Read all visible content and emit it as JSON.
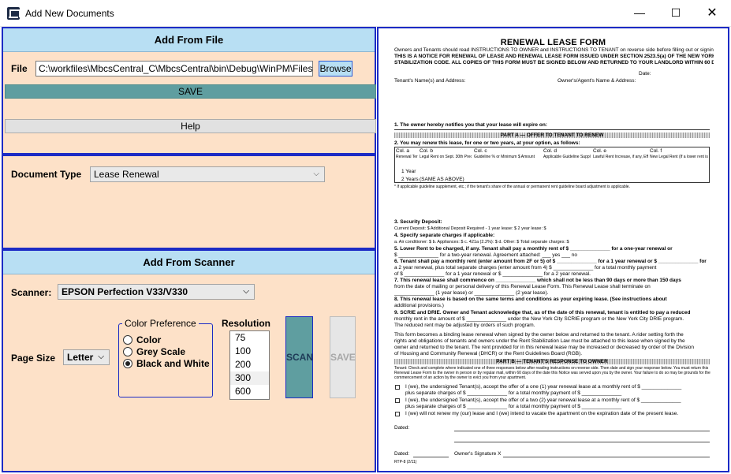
{
  "window": {
    "title": "Add New Documents",
    "controls": {
      "minimize": "—",
      "maximize": "☐",
      "close": "✕"
    }
  },
  "add_from_file": {
    "header": "Add From File",
    "file_label": "File",
    "file_value": "C:\\workfiles\\MbcsCentral_C\\MbcsCentral\\bin\\Debug\\WinPM\\Files",
    "browse_label": "Browse",
    "save_label": "SAVE",
    "help_label": "Help"
  },
  "document_type": {
    "label": "Document Type",
    "selected": "Lease Renewal"
  },
  "add_from_scanner": {
    "header": "Add From Scanner",
    "scanner_label": "Scanner:",
    "scanner_selected": "EPSON Perfection V33/V330",
    "page_size_label": "Page Size",
    "page_size_selected": "Letter",
    "color_preference": {
      "legend": "Color Preference",
      "options": [
        "Color",
        "Grey Scale",
        "Black and White"
      ],
      "selected_index": 2
    },
    "resolution": {
      "label": "Resolution",
      "options": [
        "75",
        "100",
        "200",
        "300",
        "600"
      ],
      "selected_index": 3
    },
    "scan_label": "SCAN",
    "save_label": "SAVE"
  },
  "preview": {
    "title": "RENEWAL LEASE FORM",
    "intro1": "Owners and Tenants should read INSTRUCTIONS TO OWNER and INSTRUCTIONS TO TENANT on reverse side before filling out or signing this form.",
    "intro2": "THIS IS A NOTICE FOR RENEWAL OF LEASE AND RENEWAL LEASE FORM ISSUED UNDER SECTION 2523.5(a) OF THE NEW YORK CITY RENT",
    "intro3": "STABILIZATION CODE. ALL COPIES OF THIS FORM MUST BE SIGNED BELOW AND RETURNED TO YOUR LANDLORD WITHIN 60 DAYS.",
    "date_label": "Date:",
    "tenant_label": "Tenant's Name(s) and Address:",
    "owner_label": "Owner's/Agent's Name & Address:",
    "line1": "1. The owner hereby notifies you that your lease will expire on:",
    "part_a": "PART A — OFFER TO TENANT TO RENEW",
    "line2": "2. You may renew this lease, for one or two years, at your option, as follows:",
    "cols": [
      "Col. a",
      "Col. b",
      "Col. c",
      "Col. d",
      "Col. e",
      "Col. f"
    ],
    "col_desc": [
      "Renewal Term",
      "Legal Rent on Sept. 30th Preceding Commencement Date of this Renewal Lease",
      "Guideline % or Minimum $ Amount",
      "Applicable Guideline Supplement, if any",
      "Lawful Rent Increase, if any, Effective after Sept. 30th",
      "New Legal Rent (If a lower rent is to be charged, complete item 5)"
    ],
    "row1": "1 Year",
    "row2": "2 Years",
    "row2_b": "(SAME AS ABOVE)",
    "footnote": "* If applicable guideline supplement, etc.; if the tenant's share of the annual or permanent rent guideline board adjustment is applicable.",
    "line3": "3. Security Deposit:",
    "line3b": "Current Deposit: $                     Additional Deposit Required - 1 year lease: $                     2 year lease: $",
    "line4": "4. Specify separate charges if applicable:",
    "line4b": "a. Air conditioner: $          b. Appliances: $          c. 421a (2.2%): $          d. Other: $          Total separate charges: $",
    "line5": "5. Lower Rent to be charged, if any.  Tenant shall pay a monthly rent of $ ______________ for a one-year renewal or",
    "line5b": "$ ______________ for a two-year renewal. Agreement attached:  ___ yes  ___ no",
    "line6": "6. Tenant shall pay a monthly rent (enter amount from 2F or 5) of $ ______________ for a 1 year renewal or $ ______________ for",
    "line6b": "a 2 year renewal, plus total separate charges (enter amount from 4) $ ______________ for a total monthly payment",
    "line6c": "of $ ______________ for a 1 year renewal or $ ______________ for a 2 year renewal.",
    "line7": "7. This renewal lease shall commence on ______________ which shall not be less than 90 days or more than 150 days",
    "line7b": "from the date of mailing or personal delivery of this Renewal Lease Form. This Renewal Lease shall terminate on",
    "line7c": "______________ (1 year lease) or ______________ (2 year lease).",
    "line8": "8. This renewal lease is based on the same terms and conditions as your expiring lease. (See instructions about",
    "line8b": "additional provisions.)",
    "line9": "9. SCRIE and DRIE. Owner and Tenant acknowledge that, as of the date of this renewal, tenant is entitled to pay a reduced",
    "line9b": "monthly rent in the amount of $ ______________ under the New York City SCRIE program or the New York City DRIE program.",
    "line9c": "The reduced rent may be adjusted by orders of such program.",
    "line10": "This form becomes a binding lease renewal when signed by the owner below and returned to the tenant. A rider setting forth the",
    "line10b": "rights and obligations of tenants and owners under the Rent Stabilization Law must be attached to this lease when signed by the",
    "line10c": "owner and returned to the tenant. The rent provided for in this renewal lease may be increased or decreased by order of the Division",
    "line10d": "of Housing and Community Renewal (DHCR) or the Rent Guidelines Board (RGB).",
    "part_b": "PART B — TENANT'S RESPONSE TO OWNER",
    "partb_inst": "Tenant: Check and complete where indicated one of three responses below after reading instructions on reverse side. Then date and sign your response below. You must return this Renewal Lease Form to the owner in person or by regular mail, within 60 days of the date this Notice was served upon you by the owner. Your failure to do so may be grounds for the commencement of an action by the owner to evict you from your apartment.",
    "opt1": "I (we), the undersigned Tenant(s), accept the offer of a one (1) year renewal lease at a monthly rent of $ ______________",
    "opt1b": "plus separate charges of $ ______________ for a total monthly payment of $ ______________",
    "opt2": "I (we), the undersigned Tenant(s), accept the offer of a two (2) year renewal lease at a monthly rent of $ ______________",
    "opt2b": "plus separate charges of $ ______________ for a total monthly payment of $ ______________",
    "opt3": "I (we) will not renew my (our) lease and I (we) intend to vacate the apartment on the expiration date of the present lease.",
    "dated": "Dated:",
    "dated2": "Dated:",
    "owner_sig": "Owner's Signature X",
    "footer": "RTP-8 (2/11)"
  }
}
